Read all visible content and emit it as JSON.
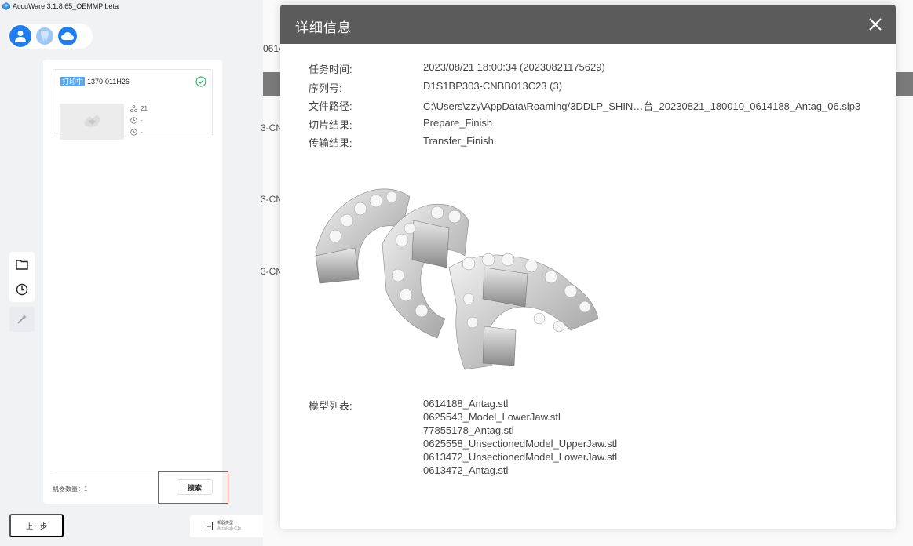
{
  "app": {
    "title": "AccuWare 3.1.8.65_OEMMP beta"
  },
  "device_card": {
    "status_badge": "打印中",
    "device_id": "1370-011H26",
    "layers": "21",
    "time_1": "-",
    "time_2": "-"
  },
  "panel": {
    "device_count": "机器数量：1",
    "search_label": "搜索"
  },
  "footer": {
    "back_label": "上一步",
    "machine_type_title": "机器类型",
    "machine_type_value": "AccuFab-C1s"
  },
  "background": {
    "top_fragment": "0614",
    "row_fragments": [
      "3-CN",
      "3-CN",
      "3-CN"
    ]
  },
  "modal": {
    "title": "详细信息",
    "fields": [
      {
        "label": "任务时间:",
        "value": "2023/08/21 18:00:34 (20230821175629)"
      },
      {
        "label": "序列号:",
        "value": "D1S1BP303-CNBB013C23 (3)"
      },
      {
        "label": "文件路径:",
        "value": "C:\\Users\\zzy\\AppData\\Roaming/3DDLP_SHIN…台_20230821_180010_0614188_Antag_06.slp3"
      },
      {
        "label": "切片结果:",
        "value": "Prepare_Finish"
      },
      {
        "label": "传输结果:",
        "value": "Transfer_Finish"
      }
    ],
    "model_list_label": "模型列表:",
    "model_list": [
      "0614188_Antag.stl",
      "0625543_Model_LowerJaw.stl",
      "77855178_Antag.stl",
      "0625558_UnsectionedModel_UpperJaw.stl",
      "0613472_UnsectionedModel_LowerJaw.stl",
      "0613472_Antag.stl"
    ]
  },
  "colors": {
    "accent": "#1f7df0",
    "modal_header": "#5b5b5b",
    "highlight_box": "#e53935",
    "status_badge": "#54a6f7",
    "success": "#34b36a"
  }
}
